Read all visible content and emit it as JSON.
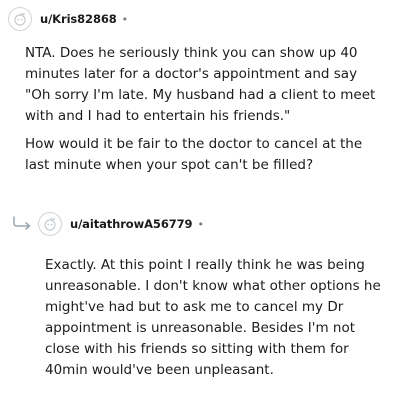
{
  "comment1": {
    "username": "u/Kris82868",
    "separator": "•",
    "paragraphs": [
      "NTA. Does he seriously think you can show up 40 minutes later for a doctor's appointment and say \"Oh sorry I'm late. My husband had a client to meet with and I had to entertain his friends.\"",
      "How would it be fair to the doctor to cancel at the last minute when your spot can't be filled?"
    ]
  },
  "comment2": {
    "username": "u/aitathrowA56779",
    "separator": "•",
    "paragraphs": [
      "Exactly. At this point I really think he was being unreasonable. I don't know what other options he might've had but to ask me to cancel my Dr appointment is unreasonable. Besides I'm not close with his friends so sitting with them for 40min would've been unpleasant."
    ]
  },
  "icons": {
    "avatar": "snoo-avatar-icon",
    "reply": "reply-arrow-icon"
  },
  "colors": {
    "text": "#1c1c1c",
    "meta": "#7c7c7c",
    "reply_arrow": "#9aa6b0"
  }
}
